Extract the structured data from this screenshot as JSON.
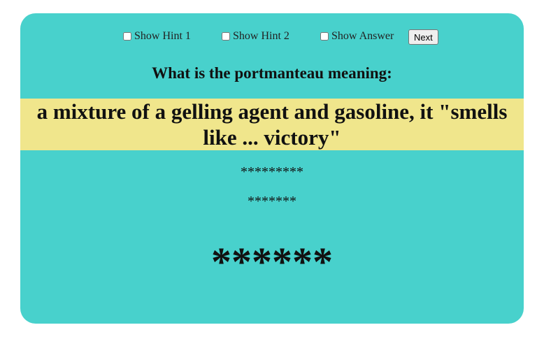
{
  "controls": {
    "hint1_label": "Show Hint 1",
    "hint2_label": "Show Hint 2",
    "answer_label": "Show Answer",
    "next_label": "Next",
    "hint1_checked": false,
    "hint2_checked": false,
    "answer_checked": false
  },
  "question": "What is the portmanteau meaning:",
  "meaning": "a mixture of a gelling agent and gasoline, it \"smells like ... victory\"",
  "hint1_masked": "*********",
  "hint2_masked": "*******",
  "answer_masked": "******",
  "colors": {
    "card_background": "#48d1cc",
    "meaning_background": "#f0e68c"
  }
}
